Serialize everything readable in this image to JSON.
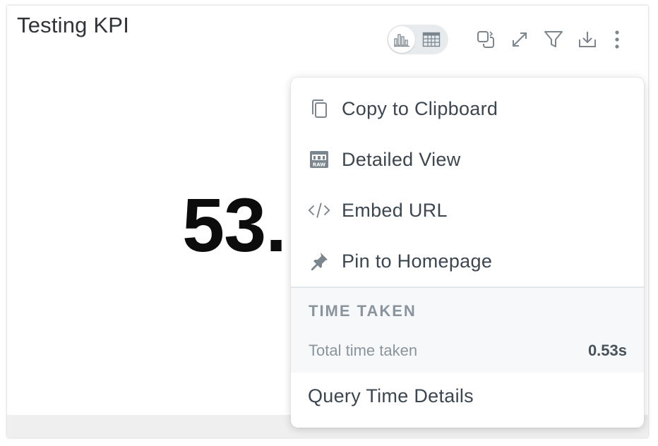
{
  "card": {
    "title": "Testing KPI",
    "kpi_value": "53."
  },
  "toolbar": {
    "view_toggle": {
      "chart_icon": "bar-chart-icon",
      "table_icon": "table-icon",
      "active": "chart"
    },
    "icons": [
      "duplicate-icon",
      "expand-icon",
      "filter-icon",
      "download-icon",
      "more-vertical-icon"
    ]
  },
  "menu": {
    "items": [
      {
        "label": "Copy to Clipboard",
        "icon": "copy-icon"
      },
      {
        "label": "Detailed View",
        "icon": "raw-data-icon"
      },
      {
        "label": "Embed URL",
        "icon": "code-icon"
      },
      {
        "label": "Pin to Homepage",
        "icon": "pin-icon"
      }
    ],
    "time_taken": {
      "heading": "TIME TAKEN",
      "label": "Total time taken",
      "value": "0.53s"
    },
    "query_details": "Query Time Details"
  },
  "colors": {
    "text_primary": "#3b4650",
    "text_muted": "#8a949c",
    "icon": "#7a858e",
    "section_bg": "#f6f8f9"
  }
}
